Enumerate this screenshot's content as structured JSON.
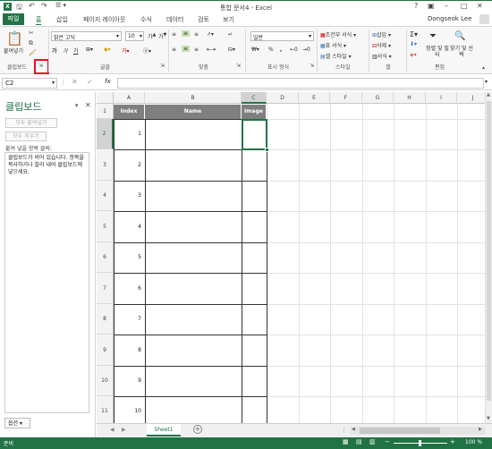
{
  "window": {
    "title": "통합 문서4 - Excel",
    "user": "Dongseok Lee"
  },
  "tabs": [
    "파일",
    "홈",
    "삽입",
    "페이지 레이아웃",
    "수식",
    "데이터",
    "검토",
    "보기"
  ],
  "ribbon": {
    "paste_label": "붙여넣기",
    "clipboard_group": "클립보드",
    "font_group": "글꼴",
    "align_group": "맞춤",
    "number_group": "표시 형식",
    "style_group": "스타일",
    "cells_group": "셀",
    "edit_group": "편집",
    "font_name": "맑은 고딕",
    "font_size": "10",
    "number_format": "일반",
    "cond_format": "조건부 서식",
    "table_format": "표 서식",
    "cell_style": "셀 스타일",
    "insert": "삽입",
    "delete": "삭제",
    "format": "서식",
    "sort_filter": "정렬 및 필터",
    "find_select": "찾기 및 선택",
    "bold": "가",
    "italic": "가",
    "underline": "가",
    "percent": "%",
    "comma": ","
  },
  "formula_bar": {
    "name_box": "C2",
    "fx": "fx",
    "value": ""
  },
  "clipboard_pane": {
    "title": "클립보드",
    "paste_all": "모두 붙여넣기",
    "clear_all": "모두 지우기",
    "instruction": "붙여 넣을 항목 클릭:",
    "empty_msg": "클립보드가 비어 있습니다. 항목을 복사하거나 잘라 내어 클립보드에 넣으세요.",
    "options": "옵션"
  },
  "grid": {
    "columns": [
      "A",
      "B",
      "C",
      "D",
      "E",
      "F",
      "G",
      "H",
      "I",
      "J"
    ],
    "rows": [
      "1",
      "2",
      "3",
      "4",
      "5",
      "6",
      "7",
      "8",
      "9",
      "10",
      "11"
    ],
    "headers": [
      "Index",
      "Name",
      "Image"
    ],
    "index_values": [
      "1",
      "2",
      "3",
      "4",
      "5",
      "6",
      "7",
      "8",
      "9",
      "10"
    ]
  },
  "sheet_tab": "Sheet1",
  "status": {
    "ready": "준비",
    "zoom": "100 %"
  },
  "colors": {
    "excel_green": "#217346",
    "header_fill": "#7f7f7f",
    "highlight": "#e81123"
  }
}
